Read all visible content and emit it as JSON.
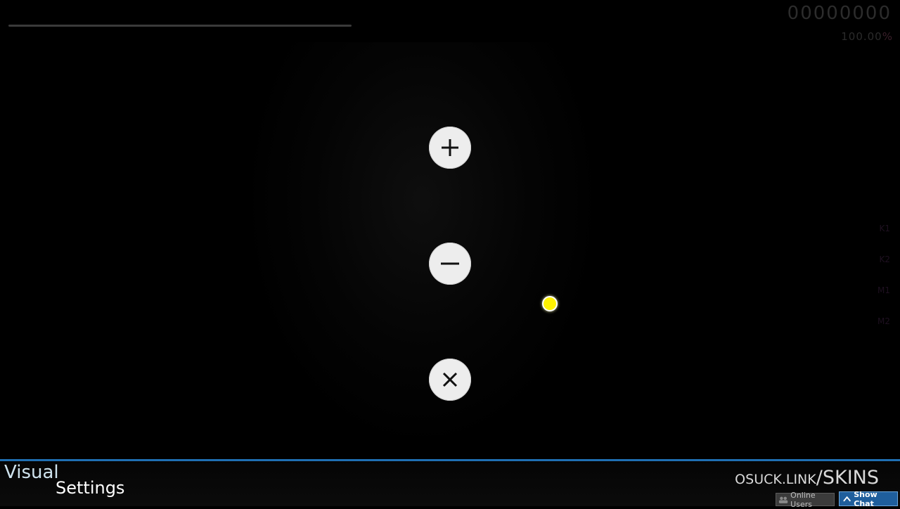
{
  "hud": {
    "score": "00000000",
    "accuracy_value": "100.00",
    "accuracy_unit": "%",
    "key_overlay": [
      "K1",
      "K2",
      "M1",
      "M2"
    ]
  },
  "menu_buttons": [
    {
      "name": "plus-icon"
    },
    {
      "name": "minus-icon"
    },
    {
      "name": "close-icon"
    }
  ],
  "bottom_bar": {
    "title_line1": "Visual",
    "title_line2": "Settings",
    "branding_prefix": "OSUCK.LINK",
    "branding_slash": "/",
    "branding_suffix": "SKINS",
    "online_users_label": "Online Users",
    "show_chat_label": "Show Chat"
  },
  "colors": {
    "accent_blue": "#1f6fb3",
    "cursor_yellow": "#fff200",
    "button_face": "#ededed"
  }
}
